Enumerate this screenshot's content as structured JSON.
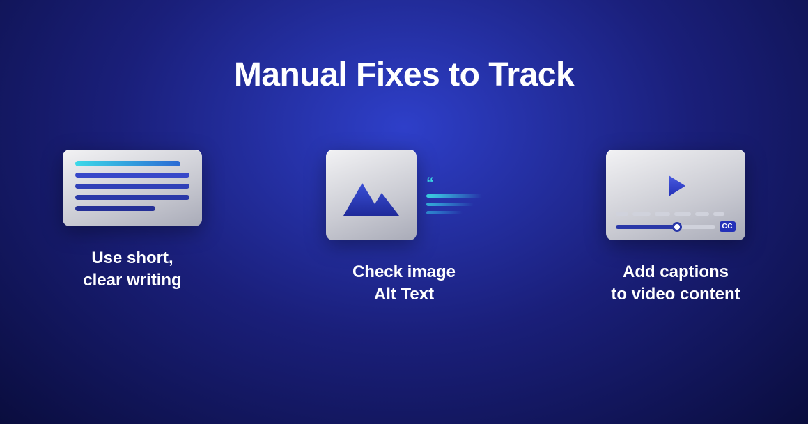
{
  "title": "Manual Fixes to Track",
  "items": [
    {
      "label": "Use short,\nclear writing",
      "icon": "text-lines-icon"
    },
    {
      "label": "Check image\nAlt Text",
      "icon": "image-alt-icon"
    },
    {
      "label": "Add captions\nto video content",
      "icon": "video-cc-icon"
    }
  ],
  "cc_label": "CC",
  "colors": {
    "bg_gradient_start": "#2e3fc9",
    "bg_gradient_end": "#0a0d3e",
    "accent_cyan": "#3dd9e8",
    "accent_blue": "#2a38a8"
  }
}
